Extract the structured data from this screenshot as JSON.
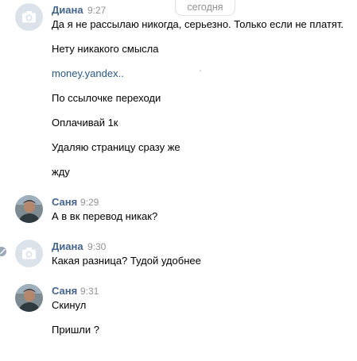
{
  "date_separator": "сегодня",
  "messages": [
    {
      "author": "Диана",
      "time": "9:27",
      "lines": [
        "Да я не рассылаю никогда, серьезно. Только если не платят.",
        "Нету никакого смысла",
        "money.yandex..",
        "По ссылочке переходи",
        "Оплачивай 1к",
        "Удаляю страницу сразу же",
        "жду"
      ]
    },
    {
      "author": "Саня",
      "time": "9:29",
      "lines": [
        "А в вк перевод никак?"
      ]
    },
    {
      "author": "Диана",
      "time": "9:30",
      "lines": [
        "Какая разница? Тудой удобнее"
      ]
    },
    {
      "author": "Саня",
      "time": "9:31",
      "lines": [
        "Скинул",
        "Пришли ?"
      ]
    }
  ],
  "icons": {
    "camera": "camera-icon",
    "unread": "check-icon"
  },
  "colors": {
    "author": "#42648b",
    "link": "#2a5885",
    "meta": "#939393",
    "placeholder_avatar": "#dbe2ea"
  }
}
